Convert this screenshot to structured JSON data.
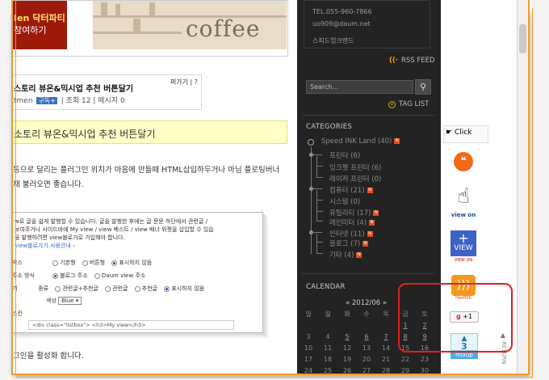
{
  "banner": {
    "left_line1": "Ien 닥터파티",
    "left_line2": "참여하기",
    "right_text": "coffee"
  },
  "post": {
    "title": "스토리 뷰온&믹시업 추천 버튼달기",
    "author": "tmen",
    "subscribe": "구독+",
    "views_label": "조회 12",
    "msg_label": "메시지 0",
    "top_actions": "퍼가기 | ?"
  },
  "yellow_title": "소토리 뷰온&믹시업 추천 버튼달기",
  "body": {
    "line1": "등으로 달리는 플러그인 위치가 마음에 안들때 HTML삽입하두거나 마님 플로팅버너",
    "line2": "재 불러오면 좋습니다.",
    "line3": "그인을 활성화 합니다."
  },
  "shot": {
    "desc1": "w로 글을 쉽게 발행할 수 있습니다. 글을 발행한 후에는 글 문문 하단에서 관련글 /",
    "desc2": "보여주거나 사이드바에 My view / view 베스트 / view 배너 위젯을 삽입할 수 있습",
    "desc3": "을 발행하려면 view블로거로 가입해야 합니다.",
    "desc_link": "view블로가기  사용안내 ›",
    "row1": {
      "label": "박스",
      "opts": [
        "기본형",
        "버튼형",
        "표시하지 않음"
      ],
      "selected": 2
    },
    "row2": {
      "label": "주소 방식",
      "opts": [
        "블로그 주소",
        "Daum view 주소"
      ],
      "selected": 0
    },
    "row3": {
      "label": "기",
      "prefix": "종류",
      "opts": [
        "관련글+추천글",
        "관련글",
        "추천글",
        "표시하지 않음"
      ],
      "selected": 3
    },
    "row4": {
      "prefix": "색상",
      "select": "Blue"
    },
    "row5": {
      "label": "스킨"
    },
    "code": "<div class=\"listbox\"> <h3>My view</h3>"
  },
  "sidebar": {
    "tel": "TEL.055-960-7866",
    "email": "uo909@daum.net",
    "brand": "스피드잉크랜드",
    "rss": "RSS FEED",
    "search_placeholder": "Search...",
    "taglist": "TAG LIST",
    "categories_head": "CATEGORIES",
    "categories": [
      {
        "label": "Speed INK Land",
        "count": "(40)"
      },
      {
        "label": "프린터",
        "count": "(6)"
      },
      {
        "label": "잉크젯 프린터",
        "count": "(6)"
      },
      {
        "label": "레이저 프린터",
        "count": "(0)"
      },
      {
        "label": "컴퓨터",
        "count": "(21)"
      },
      {
        "label": "시스템",
        "count": "(0)"
      },
      {
        "label": "유틸리티",
        "count": "(17)"
      },
      {
        "label": "레인미터",
        "count": "(4)"
      },
      {
        "label": "인터넷",
        "count": "(11)"
      },
      {
        "label": "블로그",
        "count": "(7)"
      },
      {
        "label": "기타",
        "count": "(4)"
      }
    ],
    "calendar_head": "CALENDAR",
    "calendar_nav": "«   2012/06   »",
    "weekdays": [
      "일",
      "월",
      "화",
      "수",
      "목",
      "금",
      "토"
    ],
    "weeks": [
      [
        "",
        "",
        "",
        "",
        "",
        "1",
        "2"
      ],
      [
        "3",
        "4",
        "5",
        "6",
        "7",
        "8",
        "9"
      ],
      [
        "10",
        "11",
        "12",
        "13",
        "14",
        "15",
        "16"
      ],
      [
        "17",
        "18",
        "19",
        "20",
        "21",
        "22",
        "23"
      ],
      [
        "24",
        "25",
        "26",
        "27",
        "28",
        "29",
        "30"
      ]
    ]
  },
  "widgets": {
    "click": "Click",
    "viewon": "view on",
    "view_label": "VIEW",
    "view_sub": "VIEW ON",
    "hanrss": "HanRSS",
    "plusone": "+1",
    "mixup_num": "3",
    "mixup": "mixup",
    "return": "RETURN"
  },
  "colors": {
    "accent_orange": "#f19b2c",
    "sidebar_bg": "#232323",
    "highlight_red": "#e02020"
  }
}
